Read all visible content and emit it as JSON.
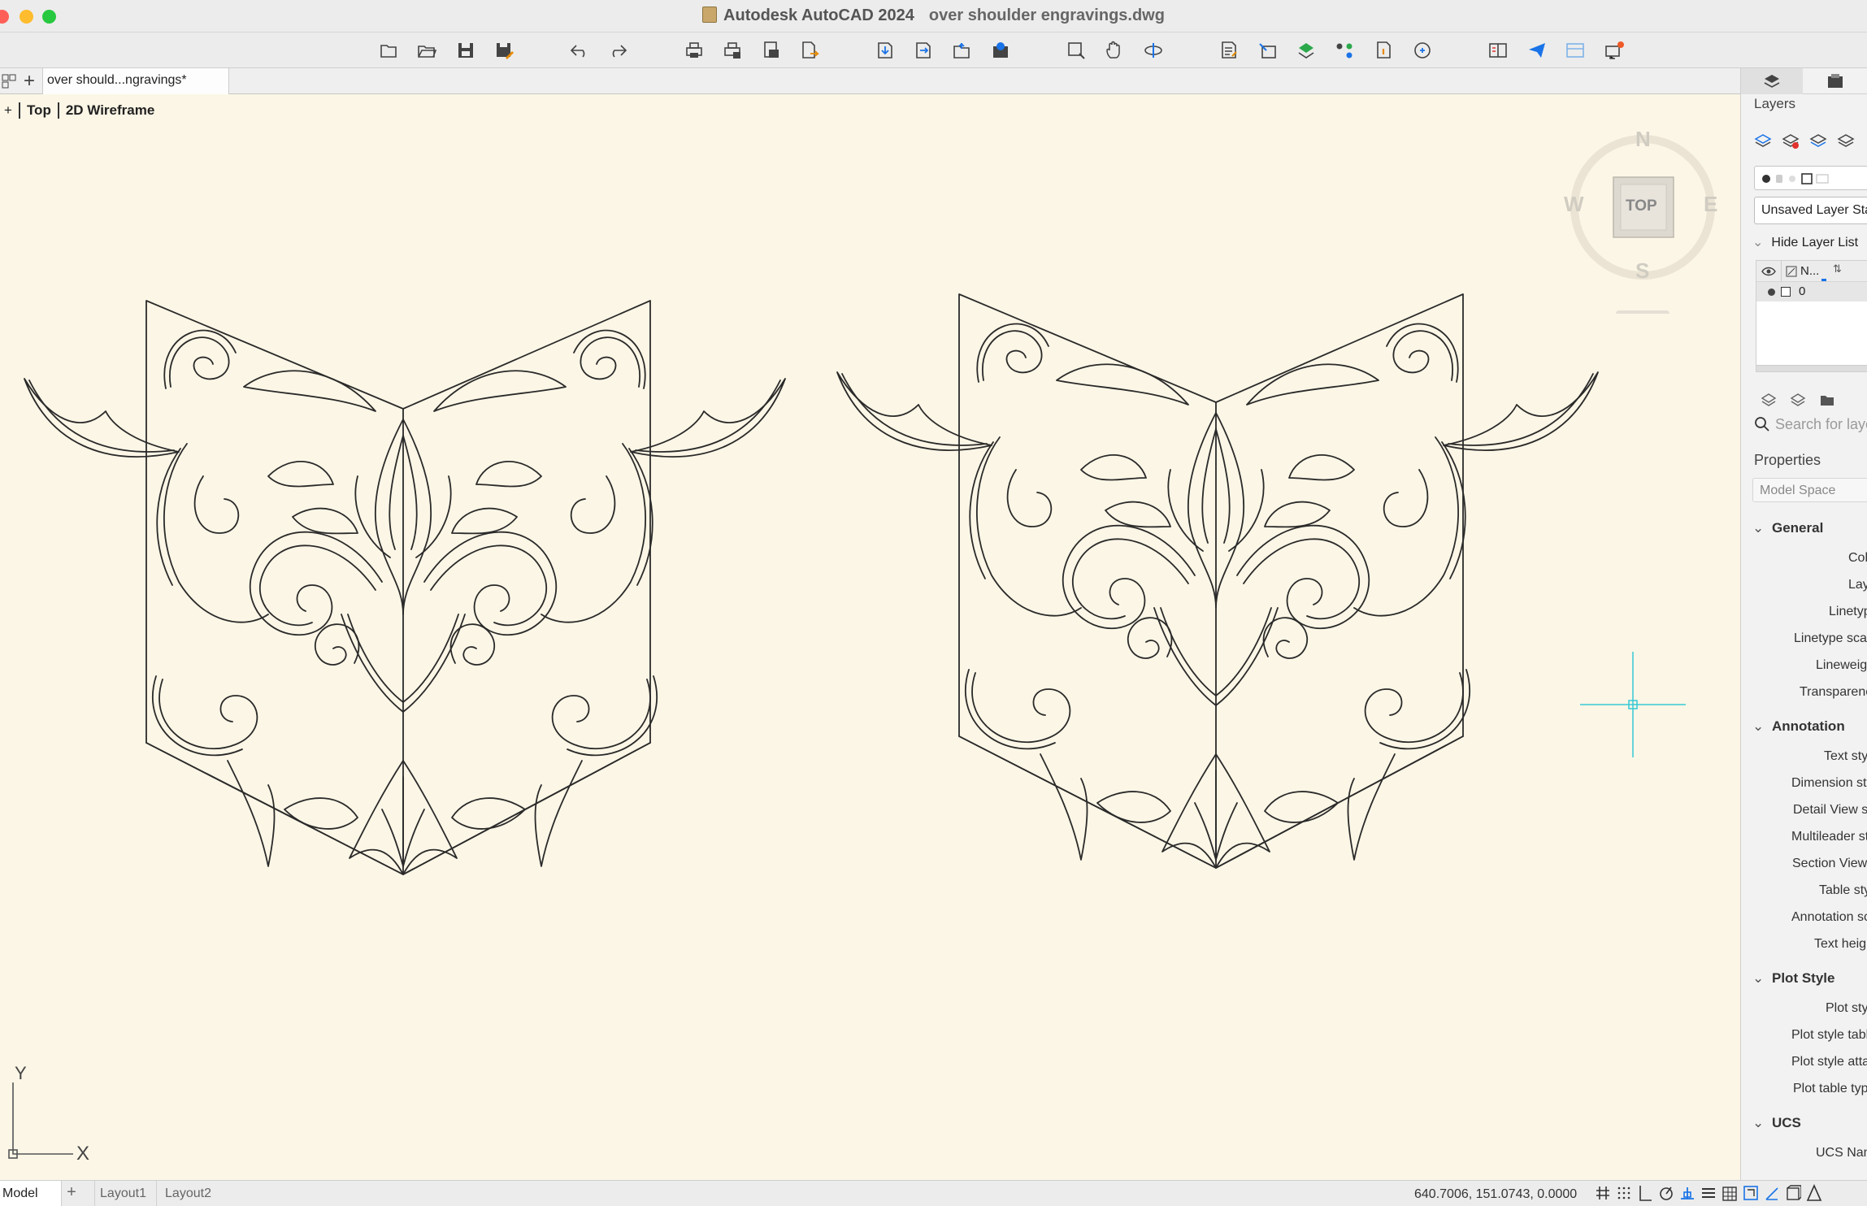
{
  "window": {
    "app_title": "Autodesk AutoCAD 2024",
    "file_title": "over shoulder engravings.dwg",
    "traffic_colors": {
      "close": "#ff5f57",
      "minimize": "#febc2e",
      "zoom": "#28c840"
    }
  },
  "toolbar": {
    "icons": [
      "new-icon",
      "open-icon",
      "save-icon",
      "save-as-icon",
      "undo-icon",
      "redo-icon",
      "plot-icon",
      "batch-plot-icon",
      "plot-preview-icon",
      "publish-icon",
      "import-icon",
      "export-icon",
      "attach-icon",
      "web-publish-icon",
      "zoom-window-icon",
      "pan-icon",
      "orbit-icon",
      "layer-properties-icon",
      "block-editor-icon",
      "xref-icon",
      "group-icon",
      "match-properties-icon",
      "quick-select-icon",
      "compare-icon",
      "share-icon",
      "markup-icon",
      "notifications-icon"
    ]
  },
  "tabs": {
    "document_tab": "over should...ngravings*"
  },
  "viewport": {
    "plus": "+",
    "view": "Top",
    "visual_style": "2D Wireframe"
  },
  "viewcube": {
    "n": "N",
    "s": "S",
    "e": "E",
    "w": "W",
    "face": "TOP"
  },
  "ucs": {
    "y": "Y",
    "x": "X"
  },
  "colors": {
    "canvas_bg": "#fcf6e6",
    "line": "#2a2a2a",
    "crosshair": "#36c9d6",
    "accent": "#1a73e8"
  },
  "layers_panel": {
    "title": "Layers",
    "state": "Unsaved Layer State",
    "hide_list": "Hide Layer List",
    "col_name": "N...",
    "layer_row": "0",
    "search_placeholder": "Search for layer"
  },
  "properties_panel": {
    "title": "Properties",
    "model_space": "Model Space",
    "groups": {
      "general": {
        "label": "General",
        "props": [
          "Color",
          "Layer",
          "Linetype",
          "Linetype scale",
          "Lineweight",
          "Transparency"
        ]
      },
      "annotation": {
        "label": "Annotation",
        "props": [
          "Text style",
          "Dimension style",
          "Detail View style",
          "Multileader style",
          "Section View style",
          "Table style",
          "Annotation scale",
          "Text height"
        ]
      },
      "plot_style": {
        "label": "Plot Style",
        "props": [
          "Plot style",
          "Plot style table",
          "Plot style attached to",
          "Plot table type"
        ]
      },
      "ucs": {
        "label": "UCS",
        "props": [
          "UCS Name"
        ]
      }
    }
  },
  "statusbar": {
    "model": "Model",
    "plus": "+",
    "layout1": "Layout1",
    "layout2": "Layout2",
    "coordinates": "640.7006, 151.0743, 0.0000"
  }
}
